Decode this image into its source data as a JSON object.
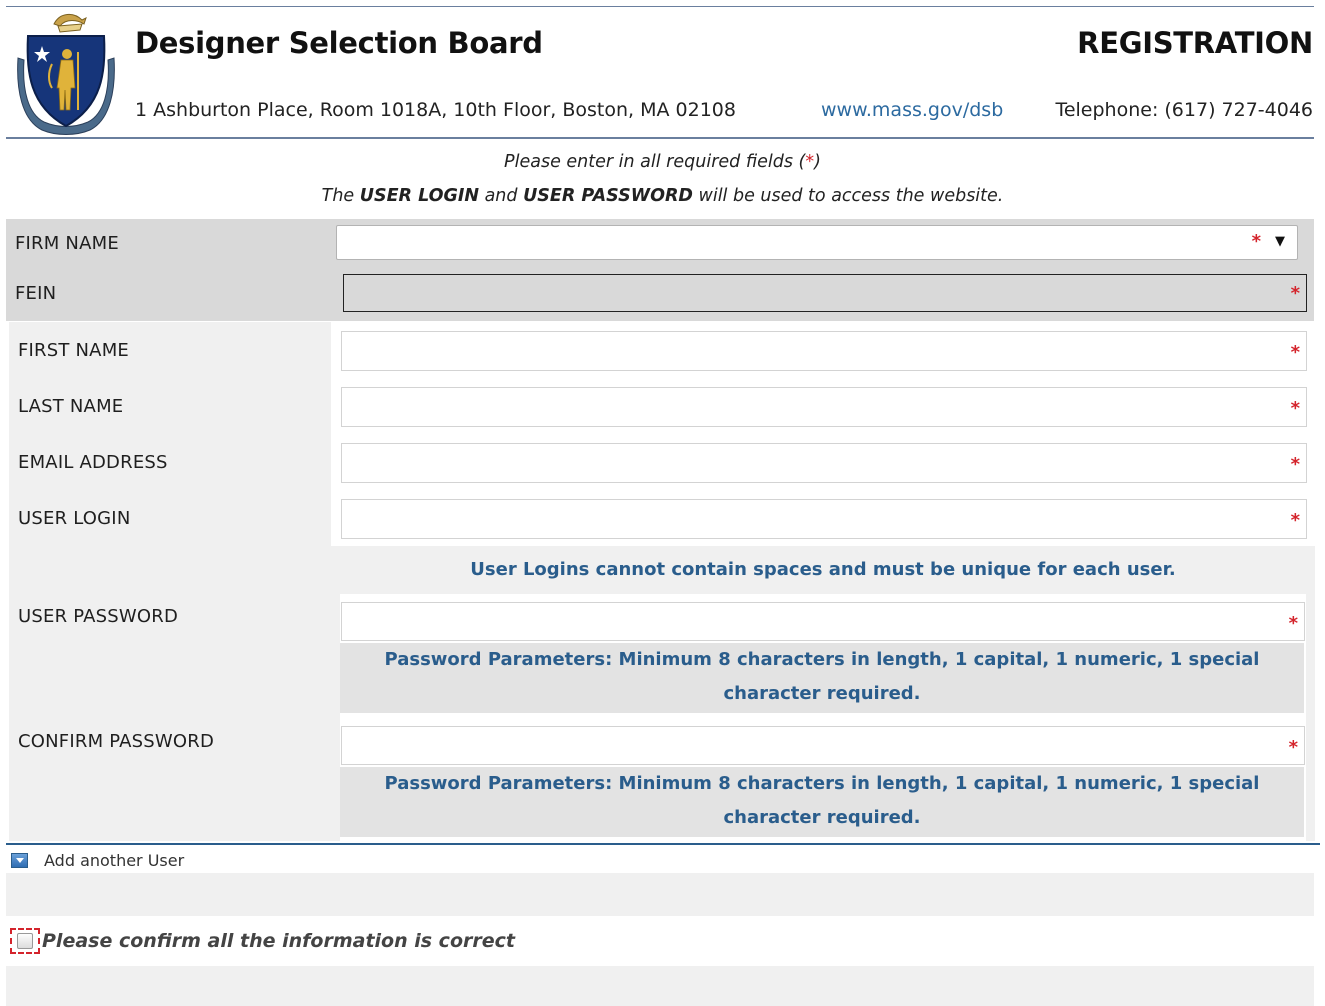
{
  "header": {
    "org_title": "Designer Selection Board",
    "page_title": "REGISTRATION",
    "address": "1 Ashburton Place, Room 1018A, 10th Floor, Boston, MA 02108",
    "website": "www.mass.gov/dsb",
    "phone": "Telephone: (617) 727-4046"
  },
  "notice": {
    "line1_text": "Please enter in all required fields (",
    "line1_star": "*",
    "line1_end": ")",
    "line2_pre": "The ",
    "line2_b1": "USER LOGIN",
    "line2_mid": " and ",
    "line2_b2": "USER PASSWORD",
    "line2_post": " will be used to access the website."
  },
  "required_marker": "*",
  "firm": {
    "firm_name_label": "FIRM NAME",
    "firm_name_value": "",
    "dropdown_arrow": "▼",
    "fein_label": "FEIN",
    "fein_value": ""
  },
  "user": {
    "first_name_label": "FIRST NAME",
    "last_name_label": "LAST NAME",
    "email_label": "EMAIL ADDRESS",
    "login_label": "USER LOGIN",
    "login_note": "User Logins cannot contain spaces and must be unique for each user.",
    "password_label": "USER PASSWORD",
    "password_note": "Password Parameters:  Minimum 8 characters in length, 1 capital, 1 numeric, 1 special character required.",
    "confirm_password_label": "CONFIRM PASSWORD",
    "confirm_password_note": "Password Parameters:  Minimum 8 characters in length, 1 capital, 1 numeric, 1 special character required."
  },
  "add_user_label": "Add another User",
  "confirm_label": "Please confirm all the information is correct",
  "colors": {
    "required": "#d4242c",
    "note_blue": "#2a5d8c",
    "link_blue": "#2c6aa0"
  }
}
